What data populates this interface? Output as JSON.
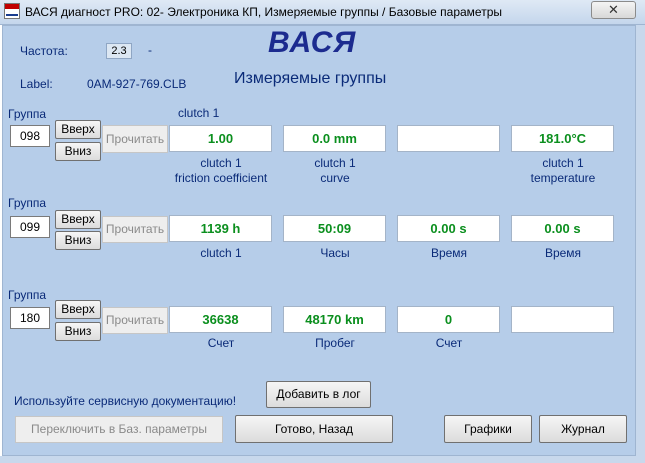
{
  "window": {
    "title": "ВАСЯ диагност PRO: 02- Электроника КП,  Измеряемые группы / Базовые параметры",
    "close_symbol": "✕"
  },
  "header": {
    "freq_label": "Частота:",
    "freq_value": "2.3",
    "freq_dash": "-",
    "label_caption": "Label:",
    "label_value": "0AM-927-769.CLB",
    "logo": "ВАСЯ",
    "subtitle": "Измеряемые группы"
  },
  "groups": [
    {
      "caption": "Группа",
      "number": "098",
      "name": "clutch 1",
      "up": "Вверх",
      "down": "Вниз",
      "read": "Прочитать",
      "values": [
        "1.00",
        "0.0 mm",
        "",
        "181.0°C"
      ],
      "labels": [
        [
          "clutch 1",
          "friction coefficient"
        ],
        [
          "clutch 1",
          "curve"
        ],
        [
          "",
          ""
        ],
        [
          "clutch 1",
          "temperature"
        ]
      ]
    },
    {
      "caption": "Группа",
      "number": "099",
      "name": "",
      "up": "Вверх",
      "down": "Вниз",
      "read": "Прочитать",
      "values": [
        "1139 h",
        "50:09",
        "0.00 s",
        "0.00 s"
      ],
      "labels": [
        [
          "clutch 1",
          ""
        ],
        [
          "Часы",
          ""
        ],
        [
          "Время",
          ""
        ],
        [
          "Время",
          ""
        ]
      ]
    },
    {
      "caption": "Группа",
      "number": "180",
      "name": "",
      "up": "Вверх",
      "down": "Вниз",
      "read": "Прочитать",
      "values": [
        "36638",
        "48170 km",
        "0",
        ""
      ],
      "labels": [
        [
          "Счет",
          ""
        ],
        [
          "Пробег",
          ""
        ],
        [
          "Счет",
          ""
        ],
        [
          "",
          ""
        ]
      ]
    }
  ],
  "footer": {
    "service_note": "Используйте сервисную документацию!",
    "add_log": "Добавить в лог",
    "switch_basic": "Переключить в Баз. параметры",
    "done_back": "Готово, Назад",
    "graphs": "Графики",
    "journal": "Журнал"
  },
  "colors": {
    "background": "#b6cde9",
    "value_text": "#0b8f1e",
    "label_text": "#0a2a78",
    "logo": "#1c2b8f"
  }
}
